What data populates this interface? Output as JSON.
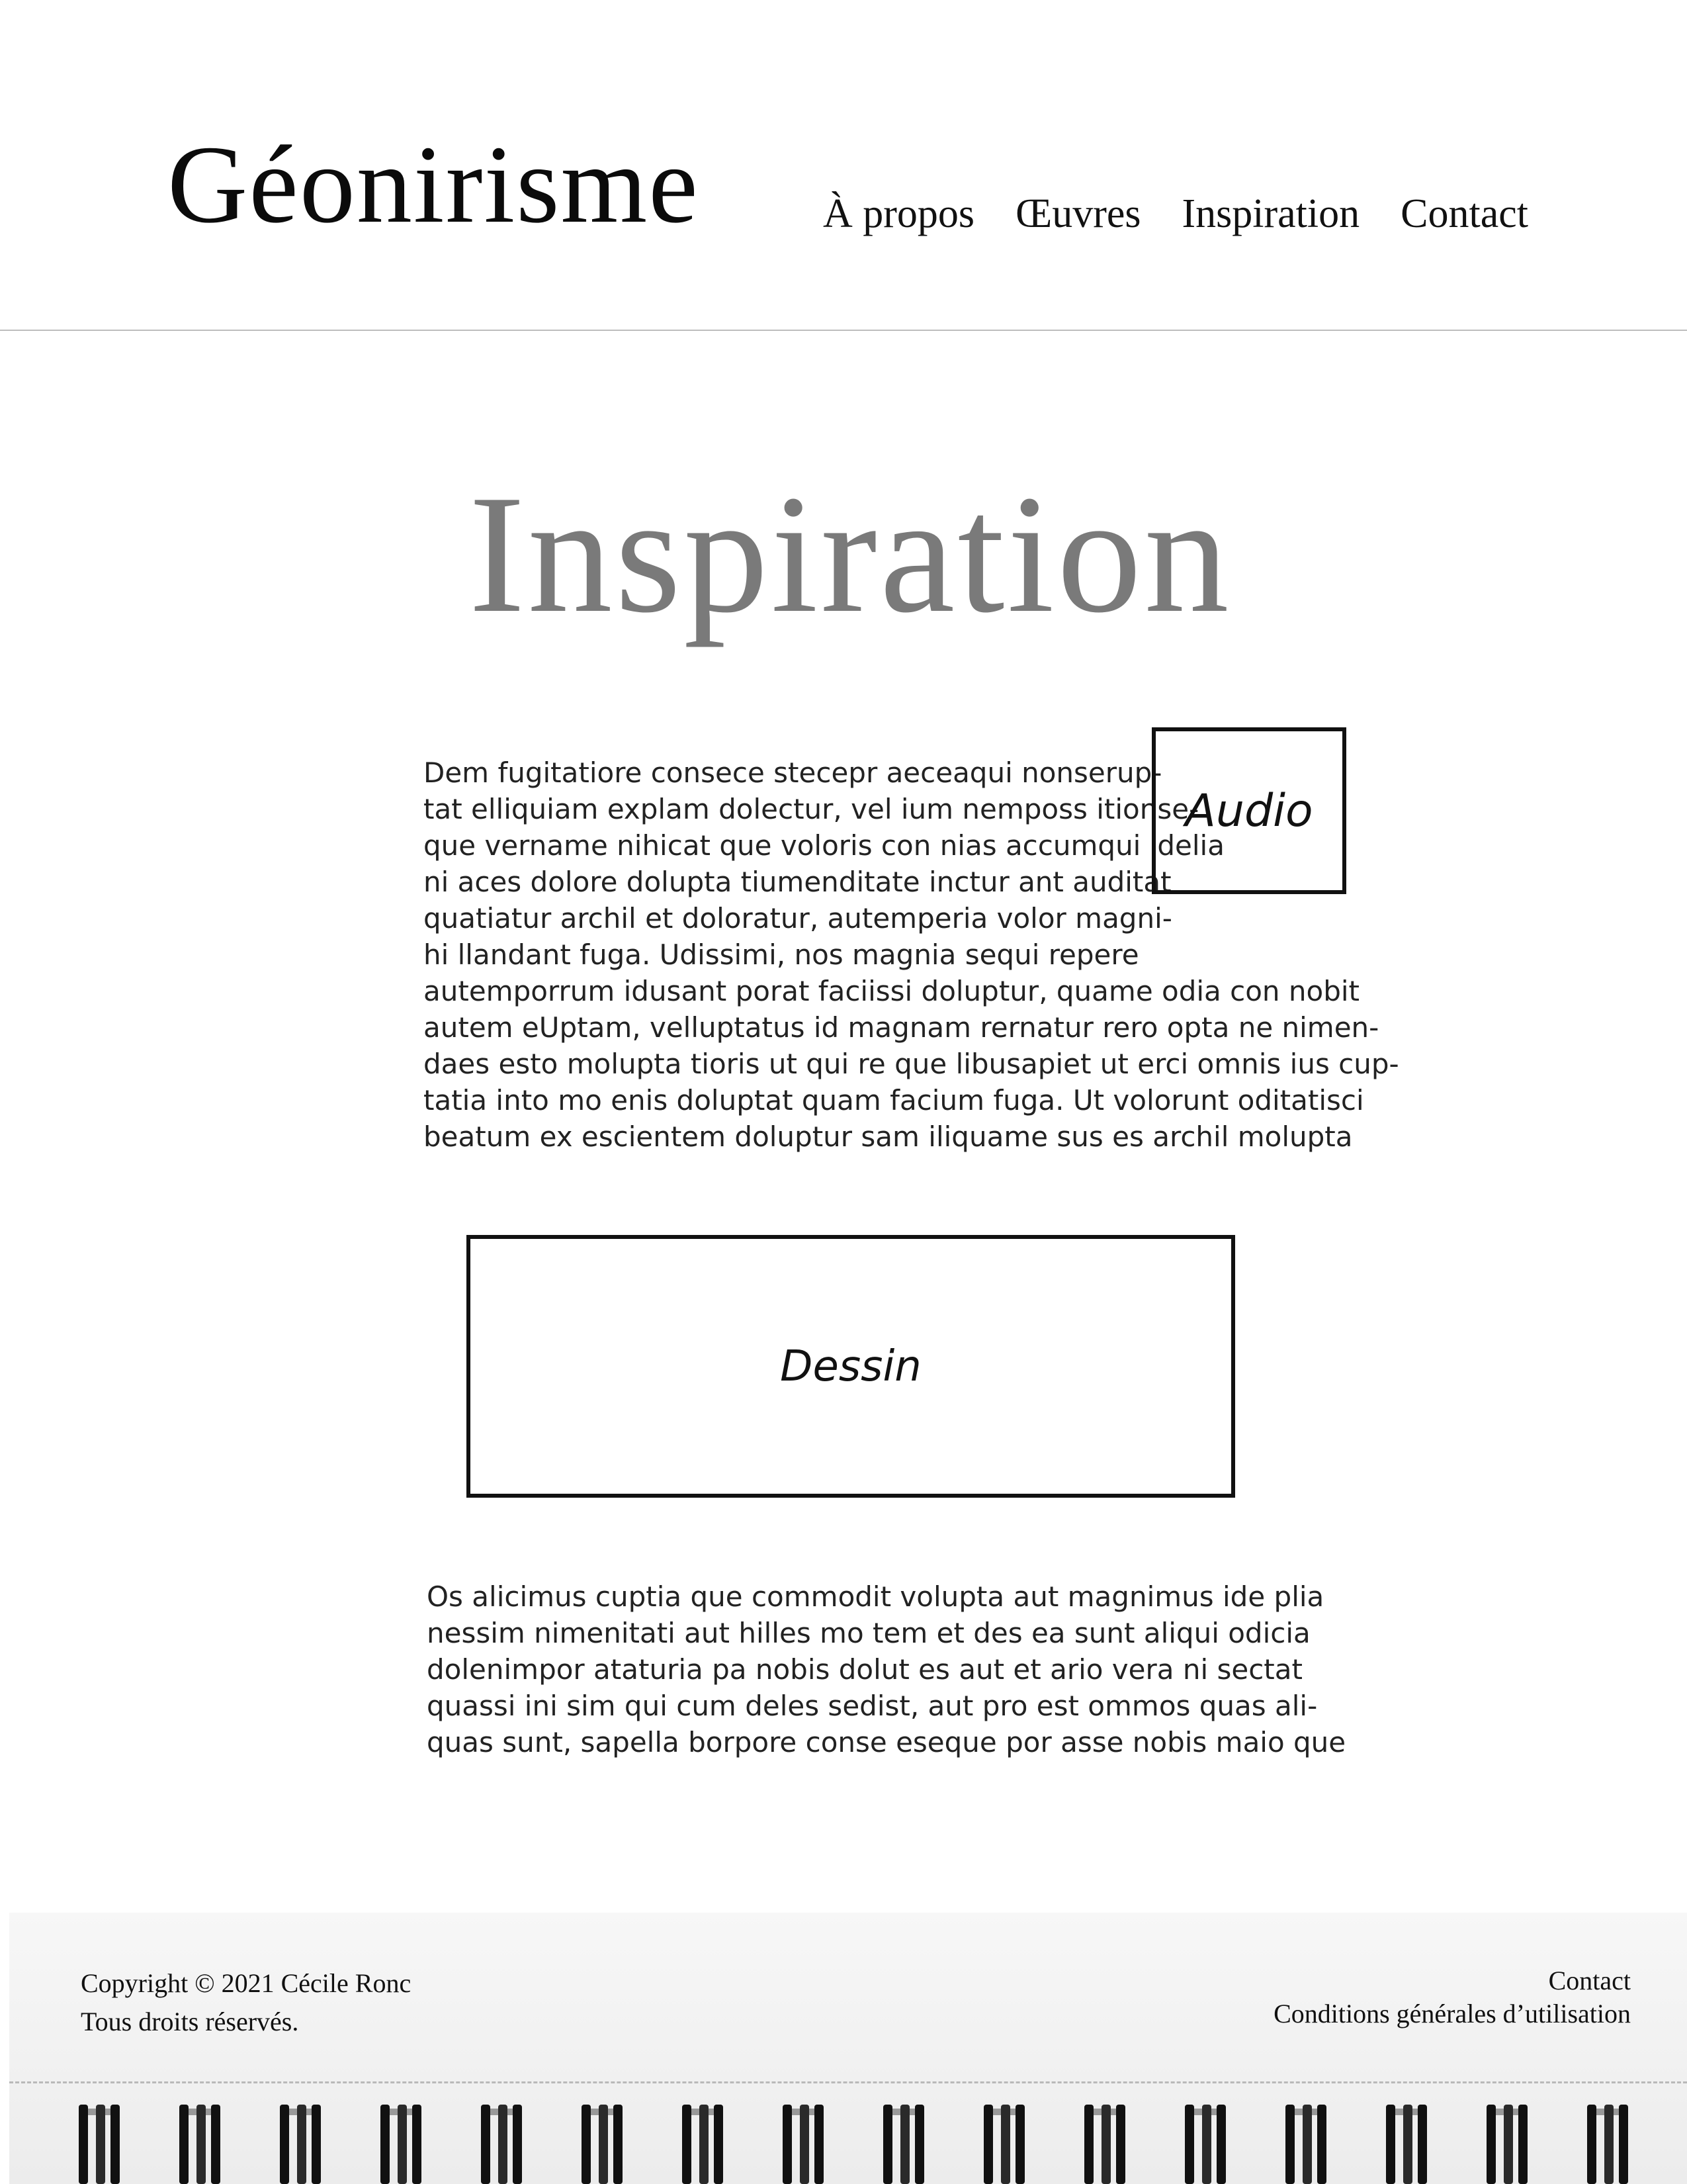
{
  "header": {
    "logo": "Géonirisme",
    "nav": [
      "À propos",
      "Œuvres",
      "Inspiration",
      "Contact"
    ]
  },
  "main": {
    "title": "Inspiration",
    "paragraph1_lines": [
      "Dem fugitatiore consece stecepr aeceaqui nonserup-",
      "tat elliquiam explam dolectur, vel ium nemposs itionse-",
      "que vername nihicat que voloris con nias accumqui idelia",
      "ni aces dolore dolupta tiumenditate inctur ant auditat",
      "quatiatur archil et doloratur, autemperia volor magni-",
      "hi llandant fuga. Udissimi, nos magnia sequi repere",
      "autemporrum idusant porat faciissi doluptur, quame odia con nobit",
      "autem eUptam, velluptatus id magnam rernatur rero opta ne nimen-",
      "daes esto molupta tioris ut qui re que libusapiet ut erci omnis ius cup-",
      "tatia into mo enis doluptat quam facium fuga. Ut volorunt oditatisci",
      "beatum ex escientem doluptur sam iliquame sus es archil molupta"
    ],
    "audio_label": "Audio",
    "dessin_label": "Dessin",
    "paragraph2_lines": [
      "Os alicimus cuptia que commodit volupta aut magnimus ide plia",
      "nessim nimenitati aut hilles mo tem et des ea sunt aliqui odicia",
      "dolenimpor ataturia pa nobis dolut es aut et ario vera ni sectat",
      "quassi ini sim qui cum deles sedist, aut pro est ommos quas ali-",
      "quas sunt, sapella borpore conse eseque por asse nobis maio que"
    ]
  },
  "footer": {
    "copyright": "Copyright © 2021 Cécile Ronc",
    "rights": "Tous droits réservés.",
    "contact": "Contact",
    "terms": "Conditions générales d’utilisation"
  }
}
